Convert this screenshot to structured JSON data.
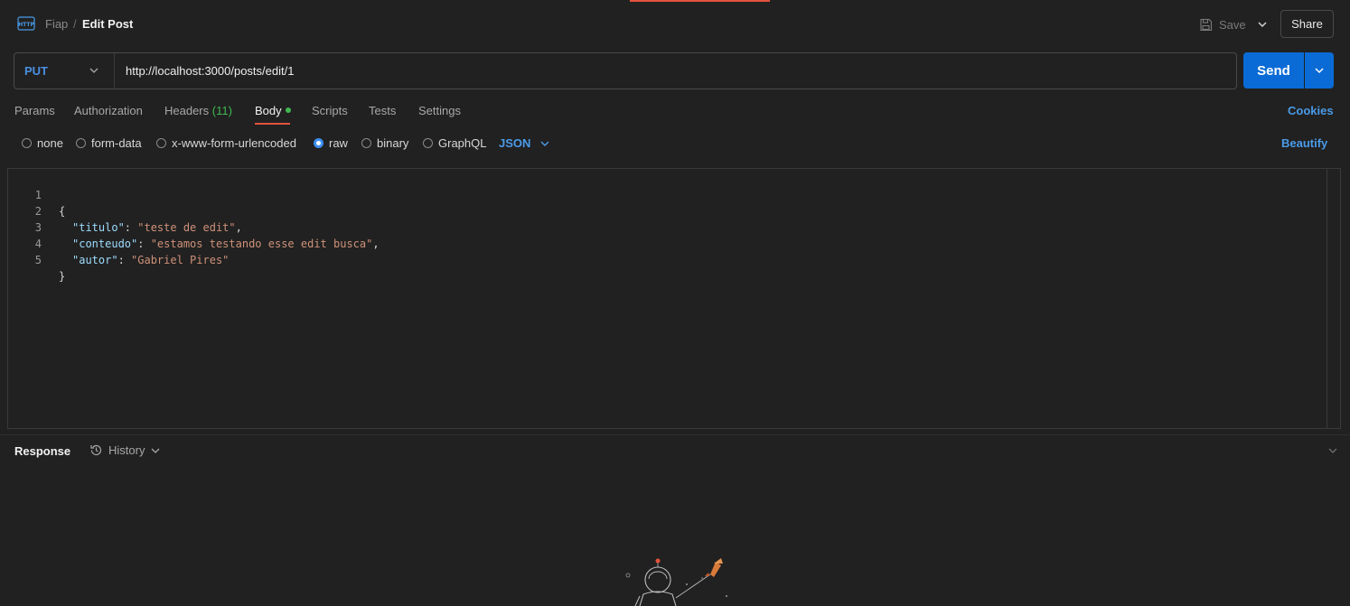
{
  "header": {
    "breadcrumb_parent": "Fiap",
    "breadcrumb_sep": "/",
    "title": "Edit Post",
    "save_label": "Save",
    "share_label": "Share"
  },
  "request": {
    "method": "PUT",
    "url": "http://localhost:3000/posts/edit/1",
    "send_label": "Send"
  },
  "tabs": {
    "params": "Params",
    "authorization": "Authorization",
    "headers": "Headers",
    "headers_count": "(11)",
    "body": "Body",
    "scripts": "Scripts",
    "tests": "Tests",
    "settings": "Settings",
    "cookies": "Cookies"
  },
  "body_types": {
    "none": "none",
    "form_data": "form-data",
    "urlencoded": "x-www-form-urlencoded",
    "raw": "raw",
    "binary": "binary",
    "graphql": "GraphQL",
    "format": "JSON",
    "beautify": "Beautify",
    "selected": "raw"
  },
  "editor": {
    "line_numbers": [
      "1",
      "2",
      "3",
      "4",
      "5"
    ],
    "open_brace": "{",
    "close_brace": "}",
    "fields": [
      {
        "key": "\"titulo\"",
        "value": "\"teste de edit\"",
        "trail": ","
      },
      {
        "key": "\"conteudo\"",
        "value": "\"estamos testando esse edit busca\"",
        "trail": ","
      },
      {
        "key": "\"autor\"",
        "value": "\"Gabriel Pires\"",
        "trail": ""
      }
    ]
  },
  "response": {
    "title": "Response",
    "history_label": "History"
  },
  "colors": {
    "accent": "#e5533d",
    "primary": "#0a6bd6",
    "link": "#4a9be8",
    "success": "#3fb950"
  }
}
